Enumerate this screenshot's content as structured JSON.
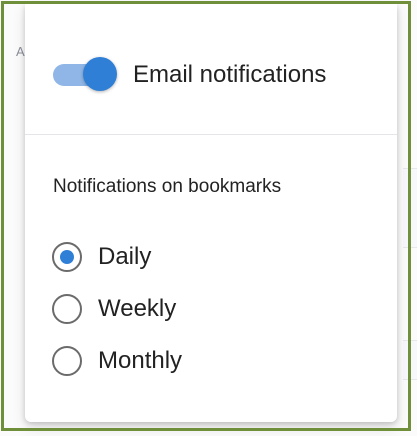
{
  "background": {
    "partial_letter": "A"
  },
  "notifications_popover": {
    "email_toggle": {
      "label": "Email notifications",
      "state": "on"
    },
    "bookmarks_section": {
      "title": "Notifications on bookmarks",
      "options": [
        {
          "label": "Daily",
          "selected": true
        },
        {
          "label": "Weekly",
          "selected": false
        },
        {
          "label": "Monthly",
          "selected": false
        }
      ]
    }
  },
  "colors": {
    "accent": "#2f7fd6",
    "toggle_track": "#8fb6e6",
    "highlight_frame": "#6f8f3a"
  },
  "icons": {
    "toggle": "toggle-switch",
    "radio": "radio-button"
  }
}
